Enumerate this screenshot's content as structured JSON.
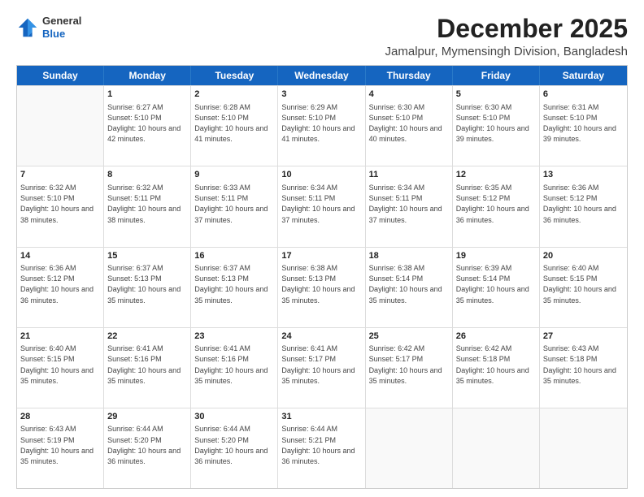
{
  "header": {
    "logo_general": "General",
    "logo_blue": "Blue",
    "month": "December 2025",
    "location": "Jamalpur, Mymensingh Division, Bangladesh"
  },
  "weekdays": [
    "Sunday",
    "Monday",
    "Tuesday",
    "Wednesday",
    "Thursday",
    "Friday",
    "Saturday"
  ],
  "rows": [
    [
      {
        "day": "",
        "sunrise": "",
        "sunset": "",
        "daylight": ""
      },
      {
        "day": "1",
        "sunrise": "Sunrise: 6:27 AM",
        "sunset": "Sunset: 5:10 PM",
        "daylight": "Daylight: 10 hours and 42 minutes."
      },
      {
        "day": "2",
        "sunrise": "Sunrise: 6:28 AM",
        "sunset": "Sunset: 5:10 PM",
        "daylight": "Daylight: 10 hours and 41 minutes."
      },
      {
        "day": "3",
        "sunrise": "Sunrise: 6:29 AM",
        "sunset": "Sunset: 5:10 PM",
        "daylight": "Daylight: 10 hours and 41 minutes."
      },
      {
        "day": "4",
        "sunrise": "Sunrise: 6:30 AM",
        "sunset": "Sunset: 5:10 PM",
        "daylight": "Daylight: 10 hours and 40 minutes."
      },
      {
        "day": "5",
        "sunrise": "Sunrise: 6:30 AM",
        "sunset": "Sunset: 5:10 PM",
        "daylight": "Daylight: 10 hours and 39 minutes."
      },
      {
        "day": "6",
        "sunrise": "Sunrise: 6:31 AM",
        "sunset": "Sunset: 5:10 PM",
        "daylight": "Daylight: 10 hours and 39 minutes."
      }
    ],
    [
      {
        "day": "7",
        "sunrise": "Sunrise: 6:32 AM",
        "sunset": "Sunset: 5:10 PM",
        "daylight": "Daylight: 10 hours and 38 minutes."
      },
      {
        "day": "8",
        "sunrise": "Sunrise: 6:32 AM",
        "sunset": "Sunset: 5:11 PM",
        "daylight": "Daylight: 10 hours and 38 minutes."
      },
      {
        "day": "9",
        "sunrise": "Sunrise: 6:33 AM",
        "sunset": "Sunset: 5:11 PM",
        "daylight": "Daylight: 10 hours and 37 minutes."
      },
      {
        "day": "10",
        "sunrise": "Sunrise: 6:34 AM",
        "sunset": "Sunset: 5:11 PM",
        "daylight": "Daylight: 10 hours and 37 minutes."
      },
      {
        "day": "11",
        "sunrise": "Sunrise: 6:34 AM",
        "sunset": "Sunset: 5:11 PM",
        "daylight": "Daylight: 10 hours and 37 minutes."
      },
      {
        "day": "12",
        "sunrise": "Sunrise: 6:35 AM",
        "sunset": "Sunset: 5:12 PM",
        "daylight": "Daylight: 10 hours and 36 minutes."
      },
      {
        "day": "13",
        "sunrise": "Sunrise: 6:36 AM",
        "sunset": "Sunset: 5:12 PM",
        "daylight": "Daylight: 10 hours and 36 minutes."
      }
    ],
    [
      {
        "day": "14",
        "sunrise": "Sunrise: 6:36 AM",
        "sunset": "Sunset: 5:12 PM",
        "daylight": "Daylight: 10 hours and 36 minutes."
      },
      {
        "day": "15",
        "sunrise": "Sunrise: 6:37 AM",
        "sunset": "Sunset: 5:13 PM",
        "daylight": "Daylight: 10 hours and 35 minutes."
      },
      {
        "day": "16",
        "sunrise": "Sunrise: 6:37 AM",
        "sunset": "Sunset: 5:13 PM",
        "daylight": "Daylight: 10 hours and 35 minutes."
      },
      {
        "day": "17",
        "sunrise": "Sunrise: 6:38 AM",
        "sunset": "Sunset: 5:13 PM",
        "daylight": "Daylight: 10 hours and 35 minutes."
      },
      {
        "day": "18",
        "sunrise": "Sunrise: 6:38 AM",
        "sunset": "Sunset: 5:14 PM",
        "daylight": "Daylight: 10 hours and 35 minutes."
      },
      {
        "day": "19",
        "sunrise": "Sunrise: 6:39 AM",
        "sunset": "Sunset: 5:14 PM",
        "daylight": "Daylight: 10 hours and 35 minutes."
      },
      {
        "day": "20",
        "sunrise": "Sunrise: 6:40 AM",
        "sunset": "Sunset: 5:15 PM",
        "daylight": "Daylight: 10 hours and 35 minutes."
      }
    ],
    [
      {
        "day": "21",
        "sunrise": "Sunrise: 6:40 AM",
        "sunset": "Sunset: 5:15 PM",
        "daylight": "Daylight: 10 hours and 35 minutes."
      },
      {
        "day": "22",
        "sunrise": "Sunrise: 6:41 AM",
        "sunset": "Sunset: 5:16 PM",
        "daylight": "Daylight: 10 hours and 35 minutes."
      },
      {
        "day": "23",
        "sunrise": "Sunrise: 6:41 AM",
        "sunset": "Sunset: 5:16 PM",
        "daylight": "Daylight: 10 hours and 35 minutes."
      },
      {
        "day": "24",
        "sunrise": "Sunrise: 6:41 AM",
        "sunset": "Sunset: 5:17 PM",
        "daylight": "Daylight: 10 hours and 35 minutes."
      },
      {
        "day": "25",
        "sunrise": "Sunrise: 6:42 AM",
        "sunset": "Sunset: 5:17 PM",
        "daylight": "Daylight: 10 hours and 35 minutes."
      },
      {
        "day": "26",
        "sunrise": "Sunrise: 6:42 AM",
        "sunset": "Sunset: 5:18 PM",
        "daylight": "Daylight: 10 hours and 35 minutes."
      },
      {
        "day": "27",
        "sunrise": "Sunrise: 6:43 AM",
        "sunset": "Sunset: 5:18 PM",
        "daylight": "Daylight: 10 hours and 35 minutes."
      }
    ],
    [
      {
        "day": "28",
        "sunrise": "Sunrise: 6:43 AM",
        "sunset": "Sunset: 5:19 PM",
        "daylight": "Daylight: 10 hours and 35 minutes."
      },
      {
        "day": "29",
        "sunrise": "Sunrise: 6:44 AM",
        "sunset": "Sunset: 5:20 PM",
        "daylight": "Daylight: 10 hours and 36 minutes."
      },
      {
        "day": "30",
        "sunrise": "Sunrise: 6:44 AM",
        "sunset": "Sunset: 5:20 PM",
        "daylight": "Daylight: 10 hours and 36 minutes."
      },
      {
        "day": "31",
        "sunrise": "Sunrise: 6:44 AM",
        "sunset": "Sunset: 5:21 PM",
        "daylight": "Daylight: 10 hours and 36 minutes."
      },
      {
        "day": "",
        "sunrise": "",
        "sunset": "",
        "daylight": ""
      },
      {
        "day": "",
        "sunrise": "",
        "sunset": "",
        "daylight": ""
      },
      {
        "day": "",
        "sunrise": "",
        "sunset": "",
        "daylight": ""
      }
    ]
  ]
}
